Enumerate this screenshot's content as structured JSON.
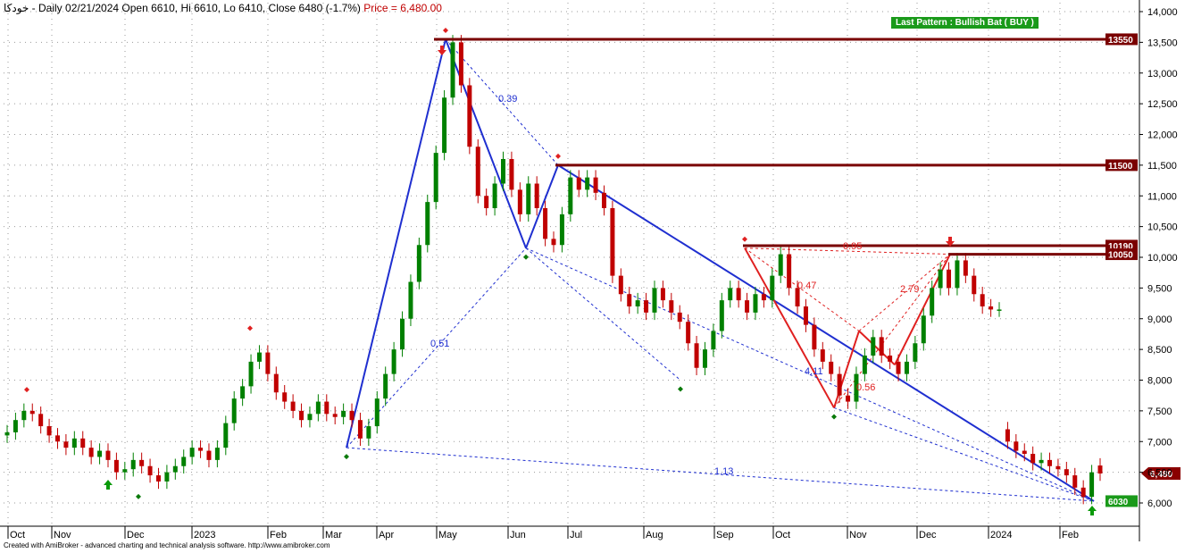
{
  "header": {
    "symbol": "خودکا",
    "text": " - Daily 02/21/2024 Open 6610, Hi 6610, Lo 6410, Close 6480 (-1.7%) ",
    "price": "Price = 6,480.00"
  },
  "footer": "Created with AmiBroker - advanced charting and technical analysis software. http://www.amibroker.com",
  "chart_data": {
    "type": "candlestick",
    "title": "",
    "xlabel": "",
    "ylabel": "",
    "ylim": [
      5600,
      14200
    ],
    "y_ticks": [
      "14,000",
      "13,500",
      "13,000",
      "12,500",
      "12,000",
      "11,500",
      "11,000",
      "10,500",
      "10,000",
      "9,500",
      "9,000",
      "8,500",
      "8,000",
      "7,500",
      "7,000",
      "6,500",
      "6,000"
    ],
    "x_ticks": [
      "Oct",
      "Nov",
      "Dec",
      "2023",
      "Feb",
      "Mar",
      "Apr",
      "May",
      "Jun",
      "Jul",
      "Aug",
      "Sep",
      "Oct",
      "Nov",
      "Dec",
      "2024",
      "Feb"
    ],
    "grid": "dotted",
    "colors": {
      "up": "#008000",
      "down": "#c00000",
      "blue_pattern": "#1f2fd0",
      "red_pattern": "#e02020",
      "level": "#7a0000",
      "badge": "#1a9a1a"
    },
    "last_pattern": "Last Pattern : Bullish Bat ( BUY )",
    "price_label": "6,480",
    "levels": [
      {
        "label": "13550",
        "value": 13550
      },
      {
        "label": "11500",
        "value": 11500
      },
      {
        "label": "10190",
        "value": 10190
      },
      {
        "label": "10050",
        "value": 10050
      },
      {
        "label": "6030",
        "value": 6030,
        "green": true
      }
    ],
    "ratios": [
      "0.39",
      "0.51",
      "1.13",
      "0.95",
      "0.47",
      "2.79",
      "4.11",
      "0.56"
    ],
    "pattern_points": {
      "X": [
        "Mar",
        6900
      ],
      "A": [
        "May",
        13550
      ],
      "B": [
        "Jun",
        10150
      ],
      "C": [
        "Jun",
        11500
      ],
      "D": [
        "Feb",
        6030
      ],
      "X2": [
        "Sep",
        10150
      ],
      "A2": [
        "Oct",
        7550
      ],
      "B2": [
        "Nov",
        8800
      ],
      "C2": [
        "Dec",
        10050
      ],
      "D2": [
        "Dec",
        9150
      ]
    },
    "candles": [
      {
        "o": 7100,
        "c": 7150
      },
      {
        "o": 7150,
        "c": 7350
      },
      {
        "o": 7350,
        "c": 7500
      },
      {
        "o": 7500,
        "c": 7450
      },
      {
        "o": 7450,
        "c": 7250
      },
      {
        "o": 7250,
        "c": 7100
      },
      {
        "o": 7100,
        "c": 7000
      },
      {
        "o": 7000,
        "c": 6900
      },
      {
        "o": 6900,
        "c": 7050
      },
      {
        "o": 7050,
        "c": 6900
      },
      {
        "o": 6900,
        "c": 6750
      },
      {
        "o": 6750,
        "c": 6850
      },
      {
        "o": 6850,
        "c": 6700
      },
      {
        "o": 6700,
        "c": 6500
      },
      {
        "o": 6500,
        "c": 6550
      },
      {
        "o": 6550,
        "c": 6700
      },
      {
        "o": 6700,
        "c": 6600
      },
      {
        "o": 6600,
        "c": 6450
      },
      {
        "o": 6450,
        "c": 6350
      },
      {
        "o": 6350,
        "c": 6500
      },
      {
        "o": 6500,
        "c": 6600
      },
      {
        "o": 6600,
        "c": 6750
      },
      {
        "o": 6750,
        "c": 6900
      },
      {
        "o": 6900,
        "c": 6850
      },
      {
        "o": 6850,
        "c": 6700
      },
      {
        "o": 6700,
        "c": 6900
      },
      {
        "o": 6900,
        "c": 7300
      },
      {
        "o": 7300,
        "c": 7700
      },
      {
        "o": 7700,
        "c": 7900
      },
      {
        "o": 7900,
        "c": 8300
      },
      {
        "o": 8300,
        "c": 8450
      },
      {
        "o": 8450,
        "c": 8100
      },
      {
        "o": 8100,
        "c": 7800
      },
      {
        "o": 7800,
        "c": 7650
      },
      {
        "o": 7650,
        "c": 7500
      },
      {
        "o": 7500,
        "c": 7350
      },
      {
        "o": 7350,
        "c": 7450
      },
      {
        "o": 7450,
        "c": 7650
      },
      {
        "o": 7650,
        "c": 7450
      },
      {
        "o": 7450,
        "c": 7400
      },
      {
        "o": 7400,
        "c": 7500
      },
      {
        "o": 7500,
        "c": 7350
      },
      {
        "o": 7350,
        "c": 7050
      },
      {
        "o": 7050,
        "c": 7250
      },
      {
        "o": 7250,
        "c": 7700
      },
      {
        "o": 7700,
        "c": 8100
      },
      {
        "o": 8100,
        "c": 8500
      },
      {
        "o": 8500,
        "c": 9000
      },
      {
        "o": 9000,
        "c": 9600
      },
      {
        "o": 9600,
        "c": 10200
      },
      {
        "o": 10200,
        "c": 10900
      },
      {
        "o": 10900,
        "c": 11700
      },
      {
        "o": 11700,
        "c": 12600
      },
      {
        "o": 12600,
        "c": 13500
      },
      {
        "o": 13500,
        "c": 12800
      },
      {
        "o": 12800,
        "c": 11800
      },
      {
        "o": 11800,
        "c": 11000
      },
      {
        "o": 11000,
        "c": 10800
      },
      {
        "o": 10800,
        "c": 11200
      },
      {
        "o": 11200,
        "c": 11600
      },
      {
        "o": 11600,
        "c": 11100
      },
      {
        "o": 11100,
        "c": 10700
      },
      {
        "o": 10700,
        "c": 11200
      },
      {
        "o": 11200,
        "c": 10800
      },
      {
        "o": 10800,
        "c": 10300
      },
      {
        "o": 10300,
        "c": 10200
      },
      {
        "o": 10200,
        "c": 10700
      },
      {
        "o": 10700,
        "c": 11300
      },
      {
        "o": 11300,
        "c": 11100
      },
      {
        "o": 11100,
        "c": 11300
      },
      {
        "o": 11300,
        "c": 11050
      },
      {
        "o": 11050,
        "c": 10800
      },
      {
        "o": 10800,
        "c": 9700
      },
      {
        "o": 9700,
        "c": 9400
      },
      {
        "o": 9400,
        "c": 9200
      },
      {
        "o": 9200,
        "c": 9300
      },
      {
        "o": 9300,
        "c": 9100
      },
      {
        "o": 9100,
        "c": 9500
      },
      {
        "o": 9500,
        "c": 9300
      },
      {
        "o": 9300,
        "c": 9100
      },
      {
        "o": 9100,
        "c": 8950
      },
      {
        "o": 8950,
        "c": 8600
      },
      {
        "o": 8600,
        "c": 8200
      },
      {
        "o": 8200,
        "c": 8500
      },
      {
        "o": 8500,
        "c": 8800
      },
      {
        "o": 8800,
        "c": 9300
      },
      {
        "o": 9300,
        "c": 9500
      },
      {
        "o": 9500,
        "c": 9300
      },
      {
        "o": 9300,
        "c": 9100
      },
      {
        "o": 9100,
        "c": 9400
      },
      {
        "o": 9400,
        "c": 9300
      },
      {
        "o": 9300,
        "c": 9700
      },
      {
        "o": 9700,
        "c": 10050
      },
      {
        "o": 10050,
        "c": 9500
      },
      {
        "o": 9500,
        "c": 9200
      },
      {
        "o": 9200,
        "c": 8900
      },
      {
        "o": 8900,
        "c": 8500
      },
      {
        "o": 8500,
        "c": 8300
      },
      {
        "o": 8300,
        "c": 8100
      },
      {
        "o": 8100,
        "c": 7750
      },
      {
        "o": 7750,
        "c": 7650
      },
      {
        "o": 7650,
        "c": 8100
      },
      {
        "o": 8100,
        "c": 8400
      },
      {
        "o": 8400,
        "c": 8700
      },
      {
        "o": 8700,
        "c": 8400
      },
      {
        "o": 8400,
        "c": 8300
      },
      {
        "o": 8300,
        "c": 8100
      },
      {
        "o": 8100,
        "c": 8300
      },
      {
        "o": 8300,
        "c": 8600
      },
      {
        "o": 8600,
        "c": 9050
      },
      {
        "o": 9050,
        "c": 9500
      },
      {
        "o": 9500,
        "c": 9800
      },
      {
        "o": 9800,
        "c": 9500
      },
      {
        "o": 9500,
        "c": 9950
      },
      {
        "o": 9950,
        "c": 9700
      },
      {
        "o": 9700,
        "c": 9400
      },
      {
        "o": 9400,
        "c": 9200
      },
      {
        "o": 9200,
        "c": 9150
      },
      {
        "o": 9150,
        "c": 9150
      },
      {
        "o": 7200,
        "c": 7000
      },
      {
        "o": 7000,
        "c": 6850
      },
      {
        "o": 6850,
        "c": 6800
      },
      {
        "o": 6800,
        "c": 6650
      },
      {
        "o": 6650,
        "c": 6700
      },
      {
        "o": 6700,
        "c": 6600
      },
      {
        "o": 6600,
        "c": 6550
      },
      {
        "o": 6550,
        "c": 6450
      },
      {
        "o": 6450,
        "c": 6250
      },
      {
        "o": 6250,
        "c": 6100
      },
      {
        "o": 6100,
        "c": 6500
      },
      {
        "o": 6610,
        "c": 6480
      }
    ]
  }
}
